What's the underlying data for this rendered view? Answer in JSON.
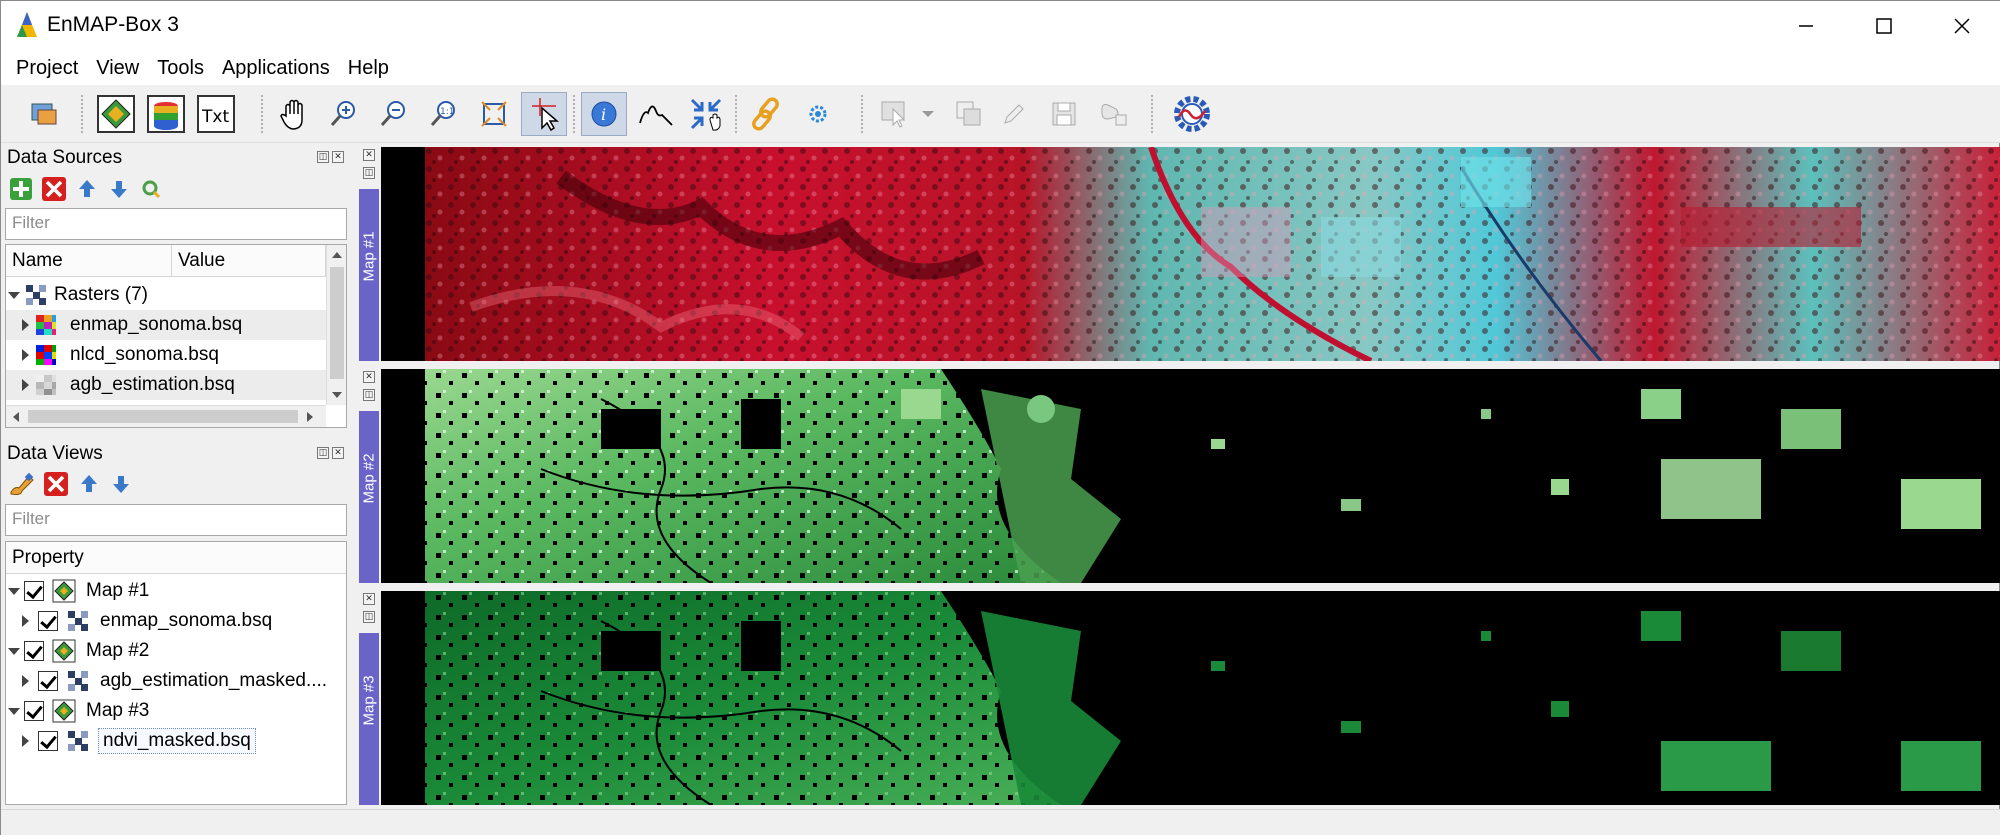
{
  "window": {
    "title": "EnMAP-Box 3"
  },
  "menu": [
    "Project",
    "View",
    "Tools",
    "Applications",
    "Help"
  ],
  "toolbar": {
    "icons": [
      "open-project-icon",
      "new-map-icon",
      "new-spectral-library-icon",
      "new-text-view-icon",
      "pan-icon",
      "zoom-in-icon",
      "zoom-out-icon",
      "zoom-native-icon",
      "zoom-full-icon",
      "crosshair-select-icon",
      "identify-icon",
      "spectral-profile-icon",
      "pan-to-center-icon",
      "link-maps-icon",
      "settings-icon",
      "select-features-icon",
      "dropdown-icon",
      "copy-features-icon",
      "edit-pencil-icon",
      "save-edits-icon",
      "add-feature-icon",
      "enmap-logo-icon"
    ]
  },
  "data_sources": {
    "title": "Data Sources",
    "filter_placeholder": "Filter",
    "columns": [
      "Name",
      "Value"
    ],
    "group": "Rasters (7)",
    "items": [
      {
        "name": "enmap_sonoma.bsq",
        "icon": "multiband-raster-icon"
      },
      {
        "name": "nlcd_sonoma.bsq",
        "icon": "classification-raster-icon"
      },
      {
        "name": "agb_estimation.bsq",
        "icon": "grayscale-raster-icon"
      }
    ]
  },
  "data_views": {
    "title": "Data Views",
    "filter_placeholder": "Filter",
    "column": "Property",
    "maps": [
      {
        "name": "Map #1",
        "layer": "enmap_sonoma.bsq"
      },
      {
        "name": "Map #2",
        "layer": "agb_estimation_masked...."
      },
      {
        "name": "Map #3",
        "layer": "ndvi_masked.bsq"
      }
    ]
  },
  "map_docks": [
    "Map #1",
    "Map #2",
    "Map #3"
  ],
  "colors": {
    "dock_tab": "#6a64c9",
    "false_color_red": "#c8102e",
    "false_color_cyan": "#5fd6d0",
    "ndvi_green": "#2e9a3e",
    "selected_row": "#ececec"
  }
}
